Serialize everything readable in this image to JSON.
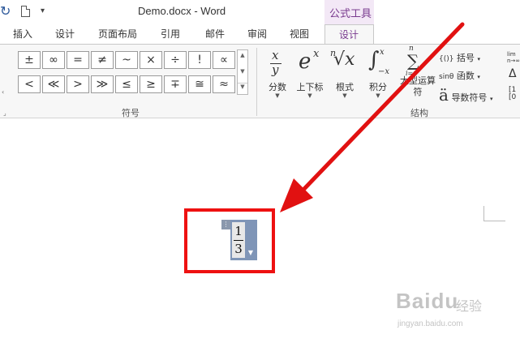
{
  "titlebar": {
    "doc_title": "Demo.docx - Word",
    "context_group": "公式工具",
    "more": "▾"
  },
  "tabs": [
    {
      "label": "插入"
    },
    {
      "label": "设计"
    },
    {
      "label": "页面布局"
    },
    {
      "label": "引用"
    },
    {
      "label": "邮件"
    },
    {
      "label": "审阅"
    },
    {
      "label": "视图"
    }
  ],
  "active_tab": {
    "label": "设计"
  },
  "symbols": {
    "row1": [
      "±",
      "∞",
      "=",
      "≠",
      "~",
      "×",
      "÷",
      "!",
      "∝"
    ],
    "row2": [
      "<",
      "≪",
      ">",
      "≫",
      "≤",
      "≥",
      "∓",
      "≅",
      "≈"
    ],
    "group_label": "符号"
  },
  "structures": {
    "fraction": {
      "label": "分数",
      "glyph_top": "x",
      "glyph_bottom": "y"
    },
    "script": {
      "label": "上下标",
      "glyph": "e",
      "sup": "x"
    },
    "radical": {
      "label": "根式",
      "glyph": "√x",
      "index": "n"
    },
    "integral": {
      "label": "积分",
      "glyph": "∫",
      "sup": "x",
      "sub": "−x"
    },
    "large_operator": {
      "label": "大型运算符",
      "glyph": "∑",
      "sub": "i=0",
      "sup": "n"
    },
    "bracket": {
      "label": "括号",
      "icon_text": "{()}"
    },
    "function": {
      "label": "函数",
      "icon_text": "sinθ"
    },
    "accent": {
      "label": "导数符号",
      "icon_text": "ä"
    },
    "group_label": "结构"
  },
  "equation": {
    "numerator": "1",
    "denominator": "3",
    "handle": "⋮"
  },
  "watermark": {
    "brand": "Baidu",
    "brand_cn": "经验",
    "url": "jingyan.baidu.com"
  },
  "colors": {
    "accent_purple": "#7a3b8f",
    "arrow_red": "#e11111",
    "equation_blue": "#7f95b7"
  }
}
